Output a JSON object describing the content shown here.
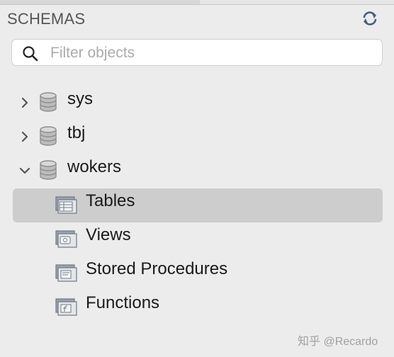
{
  "header": {
    "title": "SCHEMAS",
    "refresh_icon": "refresh-icon"
  },
  "search": {
    "placeholder": "Filter objects",
    "value": ""
  },
  "schemas": [
    {
      "name": "sys",
      "expanded": false
    },
    {
      "name": "tbj",
      "expanded": false
    },
    {
      "name": "wokers",
      "expanded": true
    }
  ],
  "wokers_children": [
    {
      "label": "Tables",
      "selected": true
    },
    {
      "label": "Views",
      "selected": false
    },
    {
      "label": "Stored Procedures",
      "selected": false
    },
    {
      "label": "Functions",
      "selected": false
    }
  ],
  "watermark": "知乎 @Recardo",
  "colors": {
    "background": "#ececec",
    "selection": "#cdcdcd",
    "text": "#1a1a1a",
    "header_text": "#555555"
  }
}
